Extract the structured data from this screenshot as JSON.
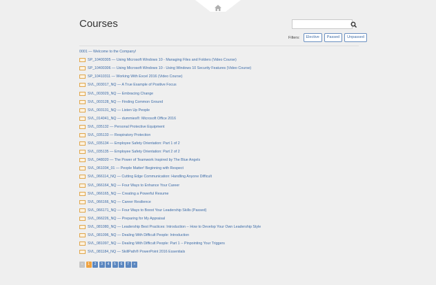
{
  "header": {
    "home_icon": "home-icon",
    "title": "Courses"
  },
  "search": {
    "placeholder": "",
    "value": "",
    "icon": "search-icon"
  },
  "filters": {
    "label": "Filters:",
    "buttons": [
      "Elective",
      "Passed",
      "Unpassed"
    ]
  },
  "courses": [
    {
      "label": "0001 — Welcome to the Company!",
      "package_icon": false
    },
    {
      "label": "SP_10400305 — Using Microsoft Windows 10 - Managing Files and Folders (Video Course)",
      "package_icon": true
    },
    {
      "label": "SP_10400306 — Using Microsoft Windows 10 - Using Windows 10 Security Features (Video Course)",
      "package_icon": true
    },
    {
      "label": "SP_10410311 — Working With Excel 2016 (Video Course)",
      "package_icon": true
    },
    {
      "label": "SVL_003017_NQ — A True Example of Positive Focus",
      "package_icon": true
    },
    {
      "label": "SVL_003029_NQ — Embracing Change",
      "package_icon": true
    },
    {
      "label": "SVL_003128_NQ — Finding Common Ground",
      "package_icon": true
    },
    {
      "label": "SVL_003131_NQ — Listen Up People",
      "package_icon": true
    },
    {
      "label": "SVL_014041_NQ — dummies®: Microsoft Office 2016",
      "package_icon": true
    },
    {
      "label": "SVL_035132 — Personal Protective Equipment",
      "package_icon": true
    },
    {
      "label": "SVL_035133 — Respiratory Protection",
      "package_icon": true
    },
    {
      "label": "SVL_035134 — Employee Safety Orientation: Part 1 of 2",
      "package_icon": true
    },
    {
      "label": "SVL_035135 — Employee Safety Orientation: Part 2 of 2",
      "package_icon": true
    },
    {
      "label": "SVL_048020 — The Power of Teamwork Inspired by The Blue Angels",
      "package_icon": true
    },
    {
      "label": "SVL_061034_01 — People Matter! Beginning with Respect",
      "package_icon": true
    },
    {
      "label": "SVL_066114_NQ — Cutting Edge Communication: Handling Anyone Difficult",
      "package_icon": true
    },
    {
      "label": "SVL_066164_NQ — Four Ways to Enhance Your Career",
      "package_icon": true
    },
    {
      "label": "SVL_066165_NQ — Creating a Powerful Resume",
      "package_icon": true
    },
    {
      "label": "SVL_066166_NQ — Career Resilience",
      "package_icon": true
    },
    {
      "label": "SVL_066171_NQ — Four Ways to Boost Your Leadership Skills (Passed)",
      "package_icon": true
    },
    {
      "label": "SVL_066226_NQ — Preparing for My Appraisal",
      "package_icon": true
    },
    {
      "label": "SVL_081080_NQ — Leadership Best Practices: Introduction -- How to Develop Your Own Leadership Style",
      "package_icon": true
    },
    {
      "label": "SVL_081096_NQ — Dealing With Difficult People: Introduction",
      "package_icon": true
    },
    {
      "label": "SVL_081097_NQ — Dealing With Difficult People: Part 1 -- Pinpointing Your Triggers",
      "package_icon": true
    },
    {
      "label": "SVL_081184_NQ — SkillPath® PowerPoint 2016 Essentials",
      "package_icon": true
    }
  ],
  "pagination": {
    "prev": "«",
    "pages": [
      "1",
      "2",
      "3",
      "4",
      "5",
      "6",
      "7"
    ],
    "current": "1",
    "next": "»"
  },
  "colors": {
    "background": "#efefef",
    "link": "#3d6ca8",
    "page_active": "#f0a340",
    "page": "#5b87c0"
  }
}
